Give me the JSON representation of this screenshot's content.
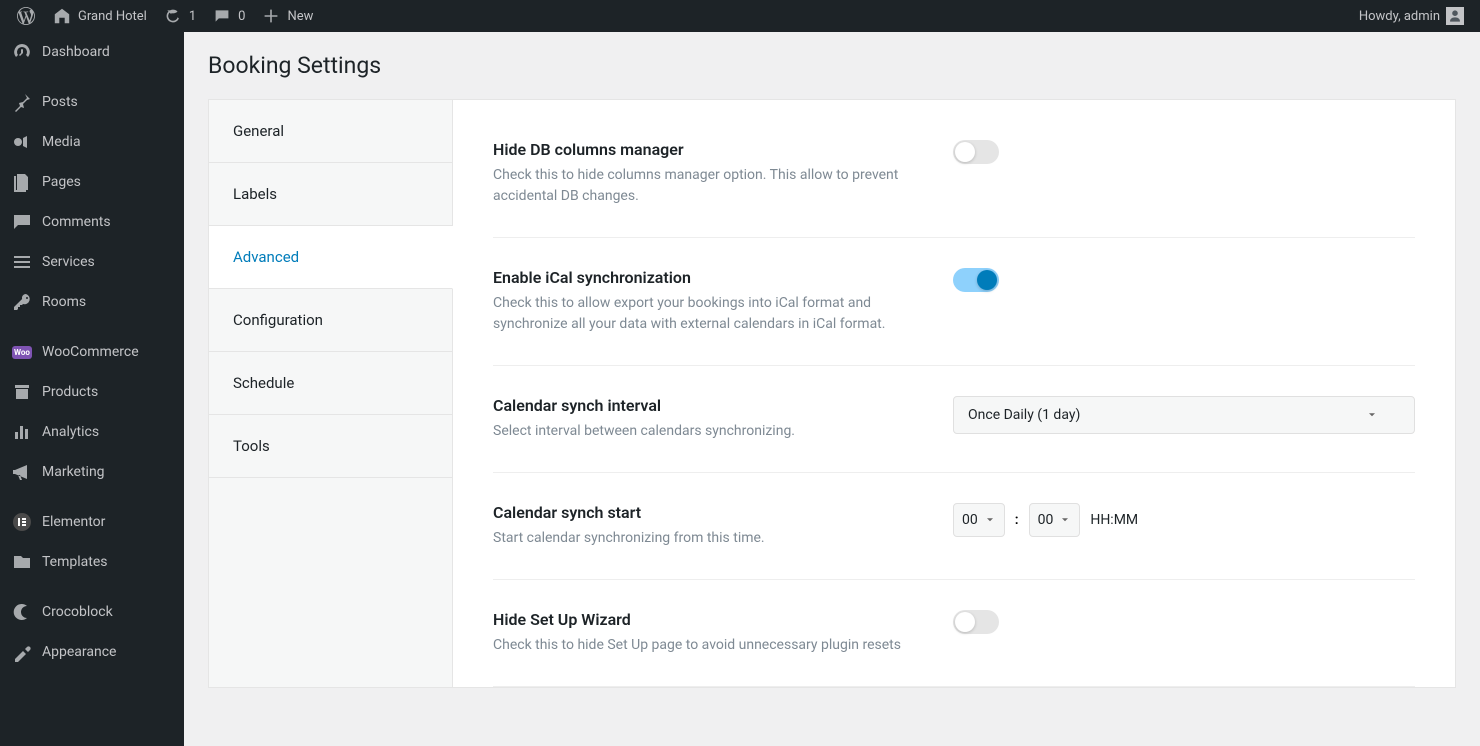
{
  "adminBar": {
    "siteName": "Grand Hotel",
    "updates": "1",
    "comments": "0",
    "newLabel": "New",
    "greeting": "Howdy, admin"
  },
  "sidebar": {
    "items": [
      {
        "label": "Dashboard",
        "icon": "dashboard"
      },
      {
        "label": "Posts",
        "icon": "pin"
      },
      {
        "label": "Media",
        "icon": "media"
      },
      {
        "label": "Pages",
        "icon": "pages"
      },
      {
        "label": "Comments",
        "icon": "comments"
      },
      {
        "label": "Services",
        "icon": "list"
      },
      {
        "label": "Rooms",
        "icon": "key"
      },
      {
        "label": "WooCommerce",
        "icon": "woo"
      },
      {
        "label": "Products",
        "icon": "products"
      },
      {
        "label": "Analytics",
        "icon": "analytics"
      },
      {
        "label": "Marketing",
        "icon": "marketing"
      },
      {
        "label": "Elementor",
        "icon": "elementor"
      },
      {
        "label": "Templates",
        "icon": "templates"
      },
      {
        "label": "Crocoblock",
        "icon": "crocoblock"
      },
      {
        "label": "Appearance",
        "icon": "appearance"
      }
    ]
  },
  "page": {
    "title": "Booking Settings"
  },
  "tabs": [
    {
      "label": "General"
    },
    {
      "label": "Labels"
    },
    {
      "label": "Advanced",
      "active": true
    },
    {
      "label": "Configuration"
    },
    {
      "label": "Schedule"
    },
    {
      "label": "Tools"
    }
  ],
  "settings": {
    "hideDb": {
      "title": "Hide DB columns manager",
      "desc": "Check this to hide columns manager option. This allow to prevent accidental DB changes.",
      "value": false
    },
    "ical": {
      "title": "Enable iCal synchronization",
      "desc": "Check this to allow export your bookings into iCal format and synchronize all your data with external calendars in iCal format.",
      "value": true
    },
    "interval": {
      "title": "Calendar synch interval",
      "desc": "Select interval between calendars synchronizing.",
      "selected": "Once Daily (1 day)"
    },
    "synchStart": {
      "title": "Calendar synch start",
      "desc": "Start calendar synchronizing from this time.",
      "hours": "00",
      "minutes": "00",
      "suffix": "HH:MM"
    },
    "hideWizard": {
      "title": "Hide Set Up Wizard",
      "desc": "Check this to hide Set Up page to avoid unnecessary plugin resets",
      "value": false
    }
  }
}
